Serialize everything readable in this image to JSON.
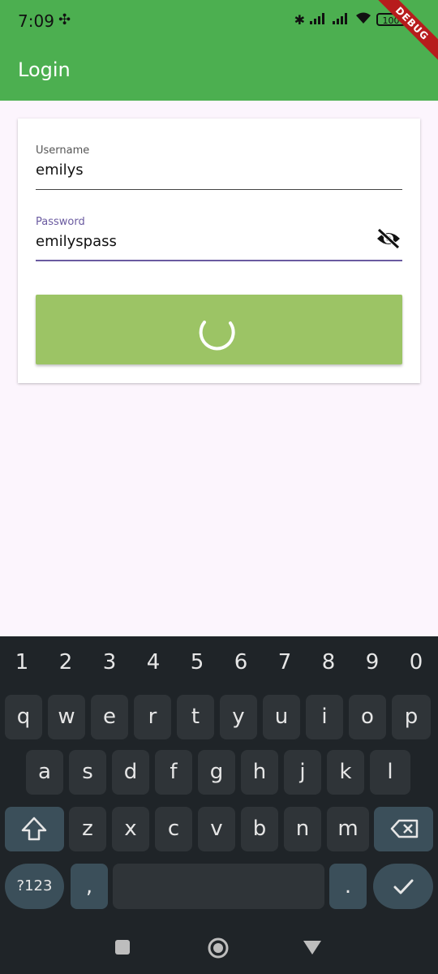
{
  "status": {
    "time": "7:09",
    "battery": "100",
    "debug_label": "DEBUG"
  },
  "appbar": {
    "title": "Login"
  },
  "form": {
    "username_label": "Username",
    "username_value": "emilys",
    "password_label": "Password",
    "password_value": "emilyspass",
    "visibility_icon": "eye-off-icon",
    "button_state": "loading"
  },
  "keyboard": {
    "numbers": [
      "1",
      "2",
      "3",
      "4",
      "5",
      "6",
      "7",
      "8",
      "9",
      "0"
    ],
    "row1": [
      "q",
      "w",
      "e",
      "r",
      "t",
      "y",
      "u",
      "i",
      "o",
      "p"
    ],
    "row2": [
      "a",
      "s",
      "d",
      "f",
      "g",
      "h",
      "j",
      "k",
      "l"
    ],
    "row3": [
      "z",
      "x",
      "c",
      "v",
      "b",
      "n",
      "m"
    ],
    "symbols_label": "?123",
    "comma": ",",
    "period": "."
  },
  "colors": {
    "primary": "#4caf50",
    "button": "#9cc465",
    "focus": "#6a5aa0",
    "keyboard_bg": "#1f2428"
  }
}
